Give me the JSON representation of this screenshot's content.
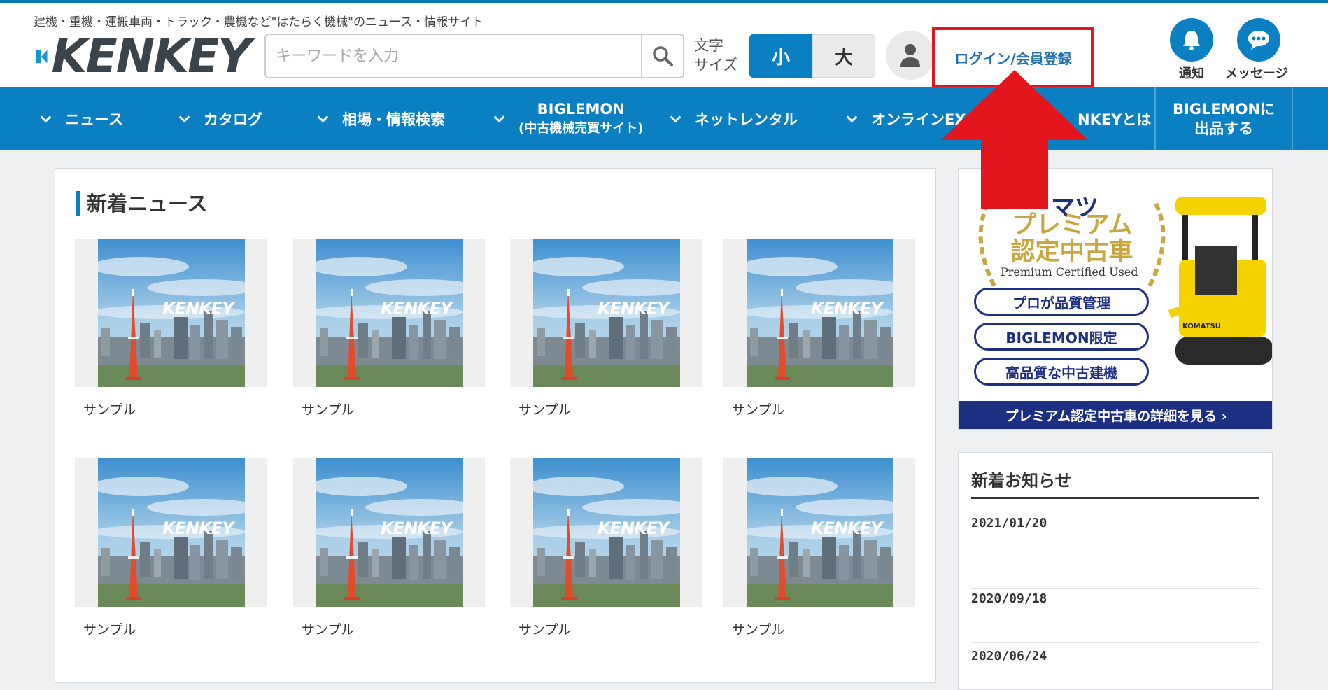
{
  "site": {
    "tagline": "建機・重機・運搬車両・トラック・農機など\"はたらく機械\"のニュース・情報サイト",
    "logo_text": "KENKEY"
  },
  "search": {
    "placeholder": "キーワードを入力"
  },
  "font_size": {
    "label_line1": "文字",
    "label_line2": "サイズ",
    "small": "小",
    "large": "大"
  },
  "account": {
    "login_label": "ログイン/会員登録"
  },
  "header_icons": {
    "notification": "通知",
    "message": "メッセージ"
  },
  "nav": {
    "items": [
      {
        "label": "ニュース"
      },
      {
        "label": "カタログ"
      },
      {
        "label": "相場・情報検索"
      },
      {
        "label": "BIGLEMON",
        "sub": "(中古機械売買サイト)"
      },
      {
        "label": "ネットレンタル"
      },
      {
        "label": "オンラインEX"
      },
      {
        "label": "NKEYとは"
      }
    ],
    "cta_line1": "BIGLEMONに",
    "cta_line2": "出品する"
  },
  "news": {
    "title": "新着ニュース",
    "photo_brand": "KENKEY",
    "items": [
      {
        "caption": "サンプル"
      },
      {
        "caption": "サンプル"
      },
      {
        "caption": "サンプル"
      },
      {
        "caption": "サンプル"
      },
      {
        "caption": "サンプル"
      },
      {
        "caption": "サンプル"
      },
      {
        "caption": "サンプル"
      },
      {
        "caption": "サンプル"
      }
    ]
  },
  "ad": {
    "brand": "マツ",
    "title_line1": "プレミアム",
    "title_line2": "認定中古車",
    "subtitle": "Premium Certified Used",
    "pills": [
      "プロが品質管理",
      "BIGLEMON限定",
      "高品質な中古建機"
    ],
    "footer": "プレミアム認定中古車の詳細を見る ›",
    "machine_label": "KOMATSU"
  },
  "notices": {
    "title": "新着お知らせ",
    "items": [
      {
        "date": "2021/01/20"
      },
      {
        "date": "2020/09/18"
      },
      {
        "date": "2020/06/24"
      }
    ]
  },
  "colors": {
    "brand_blue": "#0a7fc2",
    "highlight_red": "#e3161e",
    "ad_navy": "#1d2f80",
    "ad_gold": "#c9a740"
  }
}
